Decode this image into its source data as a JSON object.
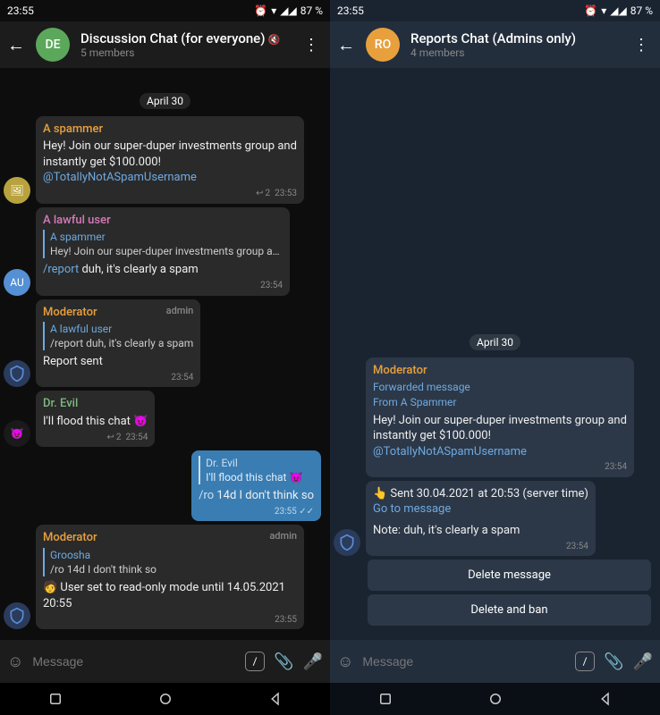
{
  "left": {
    "status": {
      "time": "23:55",
      "battery": "87 %"
    },
    "header": {
      "avatar": "DE",
      "title": "Discussion Chat (for everyone)",
      "sub": "5 members"
    },
    "date": "April 30",
    "messages": [
      {
        "name": "A spammer",
        "nameColor": "orange",
        "text": "Hey! Join our super-duper investments group and instantly get $100.000!",
        "link": "@TotallyNotASpamUsername",
        "time": "23:53",
        "replies": "2",
        "avatar": "yellow",
        "avatarText": ""
      },
      {
        "name": "A lawful user",
        "nameColor": "pink",
        "reply": {
          "name": "A spammer",
          "text": "Hey! Join our super-duper investments group and in…"
        },
        "cmd": "/report",
        "text": " duh, it's clearly a spam",
        "time": "23:54",
        "avatar": "blue",
        "avatarText": "AU"
      },
      {
        "name": "Moderator",
        "nameColor": "orange",
        "admin": "admin",
        "reply": {
          "name": "A lawful user",
          "text": "/report duh, it's clearly a spam"
        },
        "text": "Report sent",
        "time": "23:54",
        "avatar": "shield"
      },
      {
        "name": "Dr. Evil",
        "nameColor": "green",
        "text": "I'll flood this chat 😈",
        "time": "23:54",
        "replies": "2",
        "avatar": "evil"
      },
      {
        "own": true,
        "reply": {
          "name": "Dr. Evil",
          "text": "I'll flood this chat 😈"
        },
        "cmd": "/ro",
        "text": " 14d I don't think so",
        "time": "23:55 ✓✓"
      },
      {
        "name": "Moderator",
        "nameColor": "orange",
        "admin": "admin",
        "reply": {
          "name": "Groosha",
          "text": "/ro 14d I don't think so"
        },
        "text": "🧑 User set to read-only mode until 14.05.2021 20:55",
        "time": "23:55",
        "avatar": "shield"
      }
    ],
    "input": {
      "placeholder": "Message"
    }
  },
  "right": {
    "status": {
      "time": "23:55",
      "battery": "87 %"
    },
    "header": {
      "avatar": "RO",
      "title": "Reports Chat (Admins only)",
      "sub": "4 members"
    },
    "date": "April 30",
    "messages": [
      {
        "name": "Moderator",
        "nameColor": "orange",
        "fwd1": "Forwarded message",
        "fwd2": "From A Spammer",
        "text": "Hey! Join our super-duper investments group and instantly get $100.000!",
        "link": "@TotallyNotASpamUsername",
        "time": "23:54"
      },
      {
        "text1": "👆 Sent 30.04.2021 at 20:53 (server time)",
        "goto": "Go to message",
        "text2": "Note: duh, it's clearly a spam",
        "time": "23:54",
        "avatar": "shield"
      }
    ],
    "buttons": {
      "delete": "Delete message",
      "ban": "Delete and ban"
    },
    "input": {
      "placeholder": "Message"
    }
  }
}
